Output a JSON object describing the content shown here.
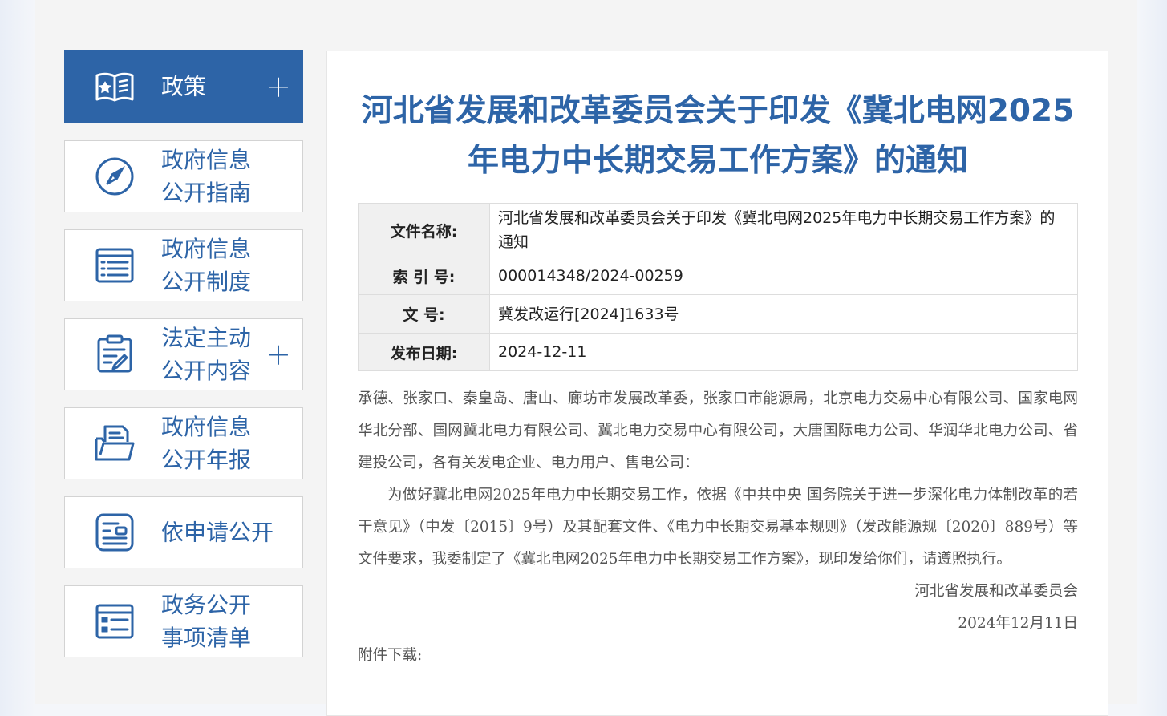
{
  "sidebar": {
    "items": [
      {
        "label": "政策",
        "icon": "book-star-icon",
        "active": true,
        "has_plus": true
      },
      {
        "label": "政府信息\n公开指南",
        "icon": "compass-icon",
        "active": false,
        "has_plus": false
      },
      {
        "label": "政府信息\n公开制度",
        "icon": "document-list-icon",
        "active": false,
        "has_plus": false
      },
      {
        "label": "法定主动\n公开内容",
        "icon": "clipboard-edit-icon",
        "active": false,
        "has_plus": true
      },
      {
        "label": "政府信息\n公开年报",
        "icon": "folder-report-icon",
        "active": false,
        "has_plus": false
      },
      {
        "label": "依申请公开",
        "icon": "id-card-icon",
        "active": false,
        "has_plus": false
      },
      {
        "label": "政务公开\n事项清单",
        "icon": "list-board-icon",
        "active": false,
        "has_plus": false
      }
    ],
    "plus_symbol": "+"
  },
  "article": {
    "title": "河北省发展和改革委员会关于印发《冀北电网2025年电力中长期交易工作方案》的通知",
    "meta": {
      "name_label": "文件名称:",
      "name_value": "河北省发展和改革委员会关于印发《冀北电网2025年电力中长期交易工作方案》的通知",
      "index_label": "索 引 号:",
      "index_value": "000014348/2024-00259",
      "docno_label": "文 号:",
      "docno_value": "冀发改运行[2024]1633号",
      "date_label": "发布日期:",
      "date_value": "2024-12-11"
    },
    "paragraphs": {
      "recipients": "承德、张家口、秦皇岛、唐山、廊坊市发展改革委，张家口市能源局，北京电力交易中心有限公司、国家电网华北分部、国网冀北电力有限公司、冀北电力交易中心有限公司，大唐国际电力公司、华润华北电力公司、省建投公司，各有关发电企业、电力用户、售电公司：",
      "body": "为做好冀北电网2025年电力中长期交易工作，依据《中共中央 国务院关于进一步深化电力体制改革的若干意见》（中发〔2015〕9号）及其配套文件、《电力中长期交易基本规则》（发改能源规〔2020〕889号）等文件要求，我委制定了《冀北电网2025年电力中长期交易工作方案》，现印发给你们，请遵照执行。",
      "signer": "河北省发展和改革委员会",
      "sign_date": "2024年12月11日",
      "attachment_label": "附件下载:"
    }
  },
  "colors": {
    "brand_blue": "#2d64a7",
    "table_key_bg": "#f0f0f0",
    "body_text": "#555555"
  }
}
